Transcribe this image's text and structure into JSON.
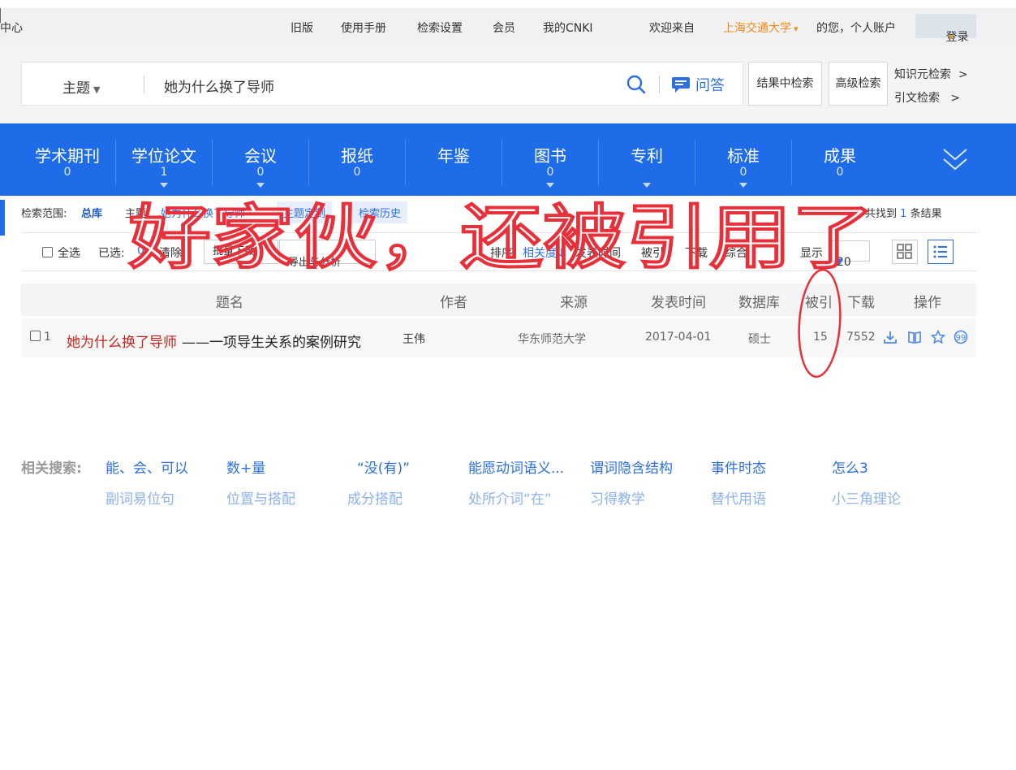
{
  "topbar": {
    "left_text": "中心",
    "links": [
      "旧版",
      "使用手册",
      "检索设置",
      "会员",
      "我的CNKI"
    ],
    "welcome": "欢迎来自",
    "institution": "上海交通大学",
    "greeting": "的您，个人账户",
    "login": "登录"
  },
  "search": {
    "field": "主题",
    "query": "她为什么换了导师",
    "qa_label": "问答",
    "in_results": "结果中检索",
    "advanced": "高级检索",
    "knowledge": "知识元检索",
    "citation": "引文检索",
    "arrow": ">"
  },
  "nav": {
    "items": [
      {
        "label": "学术期刊",
        "count": "0"
      },
      {
        "label": "学位论文",
        "count": "1"
      },
      {
        "label": "会议",
        "count": "0"
      },
      {
        "label": "报纸",
        "count": "0"
      },
      {
        "label": "年鉴",
        "count": ""
      },
      {
        "label": "图书",
        "count": "0"
      },
      {
        "label": "专利",
        "count": ""
      },
      {
        "label": "标准",
        "count": "0"
      },
      {
        "label": "成果",
        "count": "0"
      }
    ]
  },
  "scope": {
    "label": "检索范围:",
    "value": "总库",
    "topic_label": "主题:",
    "topic_value": "她为什么换了导师",
    "chip_custom": "主题定制",
    "chip_history": "检索历史",
    "found_prefix": "共找到",
    "found_count": "1",
    "found_suffix": "条结果"
  },
  "toolbar": {
    "select_all": "全选",
    "selected_label": "已选:",
    "selected_count": "0",
    "clear": "清除",
    "batch_download": "批量下载",
    "export": "导出与分析",
    "sort_label": "排序:",
    "sort_relevance": "相关度",
    "sort_date": "发表时间",
    "sort_cited": "被引",
    "sort_download": "下载",
    "sort_overall": "综合",
    "show_label": "显示",
    "page_size": "20"
  },
  "table": {
    "headers": [
      "题名",
      "作者",
      "来源",
      "发表时间",
      "数据库",
      "被引",
      "下载",
      "操作"
    ],
    "rows": [
      {
        "num": "1",
        "title_hl": "她为什么换了导师",
        "title_rest": "——一项导生关系的案例研究",
        "author": "王伟",
        "source": "华东师范大学",
        "date": "2017-04-01",
        "db": "硕士",
        "cited": "15",
        "downloads": "7552"
      }
    ]
  },
  "related": {
    "label": "相关搜索:",
    "row1": [
      "能、会、可以",
      "数+量",
      "“没(有)”",
      "能愿动词语义...",
      "谓词隐含结构",
      "事件时态",
      "怎么3"
    ],
    "row2": [
      "副词易位句",
      "位置与搭配",
      "成分搭配",
      "处所介词“在”",
      "习得教学",
      "替代用语",
      "小三角理论"
    ]
  },
  "annotation": {
    "text": "好家伙，还被引用了"
  },
  "colors": {
    "brand_blue": "#1e6ce8",
    "highlight_red": "#c7231a",
    "annotation_red": "#e8303a",
    "institution_orange": "#f08a1c"
  }
}
